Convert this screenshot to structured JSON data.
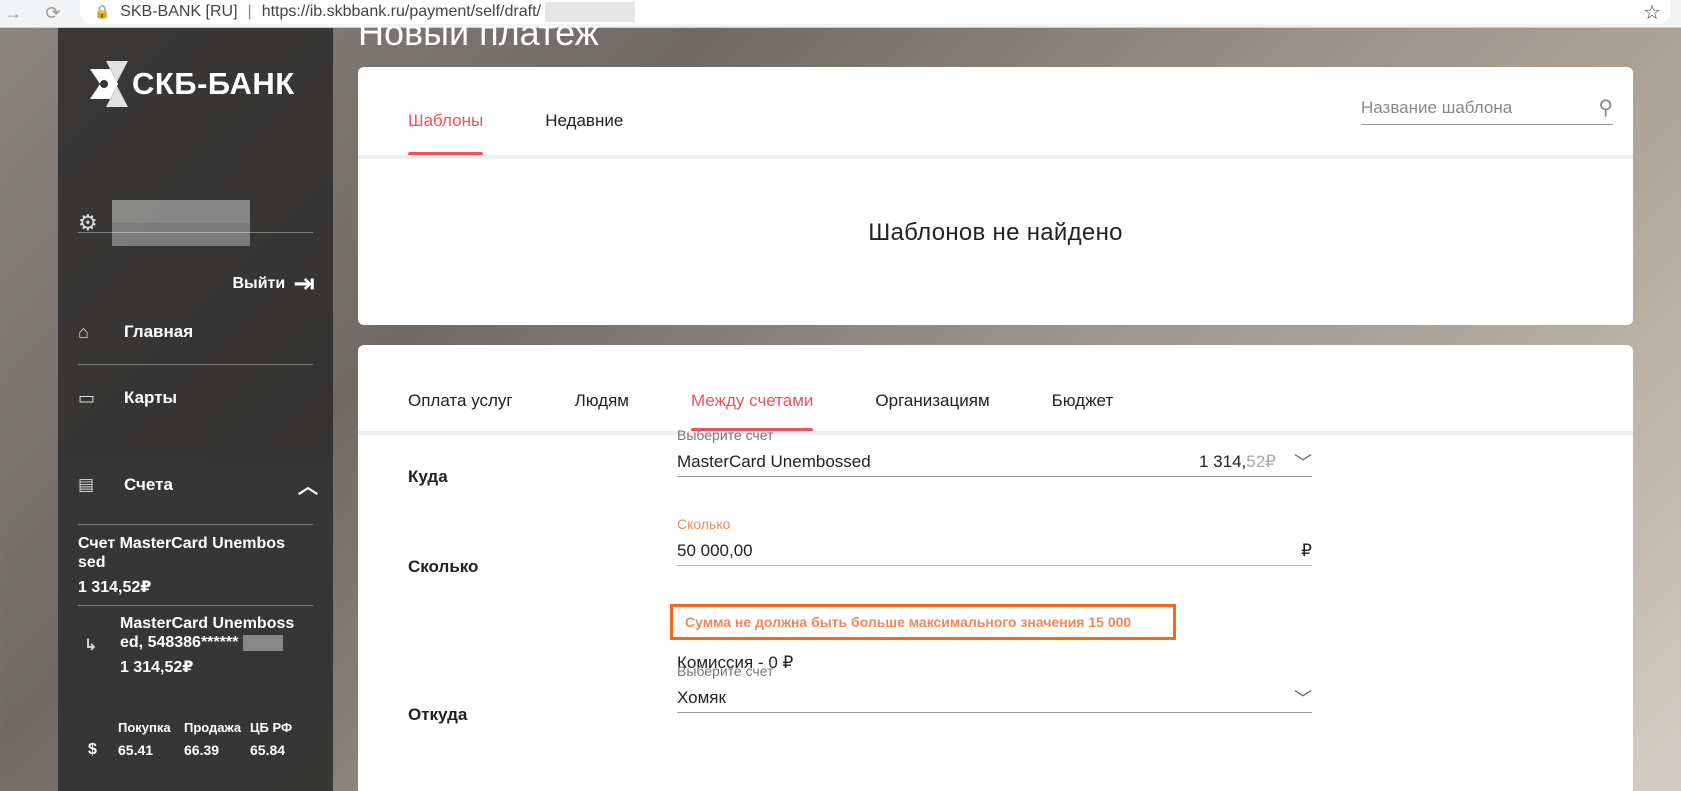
{
  "browser": {
    "site_name": "SKB-BANK [RU]",
    "url": "https://ib.skbbank.ru/payment/self/draft/"
  },
  "sidebar": {
    "logo_text": "СКБ-БАНК",
    "logout_label": "Выйти",
    "nav": [
      {
        "label": "Главная",
        "icon": "home-icon"
      },
      {
        "label": "Карты",
        "icon": "card-icon"
      }
    ],
    "accounts": {
      "label": "Счета",
      "main_account": {
        "name": "Счет MasterCard Unembos sed",
        "balance": "1 314,52₽"
      },
      "card": {
        "name": "MasterCard Unemboss ed, 548386******",
        "balance": "1 314,52₽"
      }
    },
    "rates": {
      "headers": [
        "Покупка",
        "Продажа",
        "ЦБ РФ"
      ],
      "currency": "$",
      "values": [
        "65.41",
        "66.39",
        "65.84"
      ]
    }
  },
  "page_title": "Новый платеж",
  "templates": {
    "tabs": [
      "Шаблоны",
      "Недавние"
    ],
    "search_placeholder": "Название шаблона",
    "empty_message": "Шаблонов не найдено"
  },
  "payment": {
    "tabs": [
      "Оплата услуг",
      "Людям",
      "Между счетами",
      "Организациям",
      "Бюджет"
    ],
    "to": {
      "label": "Куда",
      "hint": "Выберите счет",
      "value": "MasterCard Unembossed",
      "balance_int": "1 314,",
      "balance_frac": "52₽"
    },
    "amount": {
      "label": "Сколько",
      "hint": "Сколько",
      "value": "50 000,00",
      "currency": "₽",
      "error": "Сумма не должна быть больше максимального значения 15 000",
      "commission": "Комиссия - 0 ₽"
    },
    "from": {
      "label": "Откуда",
      "hint": "Выберите счет",
      "value": "Хомяк"
    }
  },
  "colors": {
    "accent": "#e9555c",
    "error_border": "#f26a1b",
    "error_text": "#f0875a"
  }
}
